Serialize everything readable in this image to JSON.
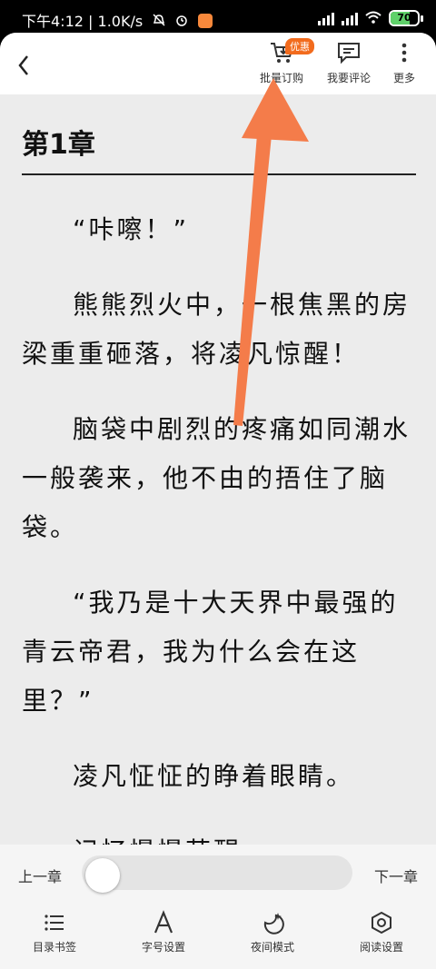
{
  "status_bar": {
    "time": "下午4:12",
    "network_speed": "1.0K/s",
    "battery": "70",
    "battery_level": 0.7
  },
  "top_bar": {
    "bulk_order_label": "批量订购",
    "promo_badge": "优惠",
    "comment_label": "我要评论",
    "more_label": "更多"
  },
  "chapter": {
    "title": "第1章",
    "paragraphs": [
      "“咔嚓！”",
      "熊熊烈火中，一根焦黑的房梁重重砸落，将凌凡惊醒！",
      "脑袋中剧烈的疼痛如同潮水一般袭来，他不由的捂住了脑袋。",
      "“我乃是十大天界中最强的青云帝君，我为什么会在这里？”",
      "凌凡怔怔的睁着眼睛。",
      "记忆慢慢苏醒。"
    ]
  },
  "progress": {
    "prev_label": "上一章",
    "next_label": "下一章",
    "value": 0
  },
  "bottom_nav": {
    "items": [
      {
        "label": "目录书签",
        "icon": "list-icon"
      },
      {
        "label": "字号设置",
        "icon": "font-size-icon"
      },
      {
        "label": "夜间模式",
        "icon": "moon-icon"
      },
      {
        "label": "阅读设置",
        "icon": "settings-icon"
      }
    ]
  },
  "colors": {
    "accent": "#f26b1d",
    "arrow": "#f47c4a",
    "reader_bg": "#ececec"
  }
}
